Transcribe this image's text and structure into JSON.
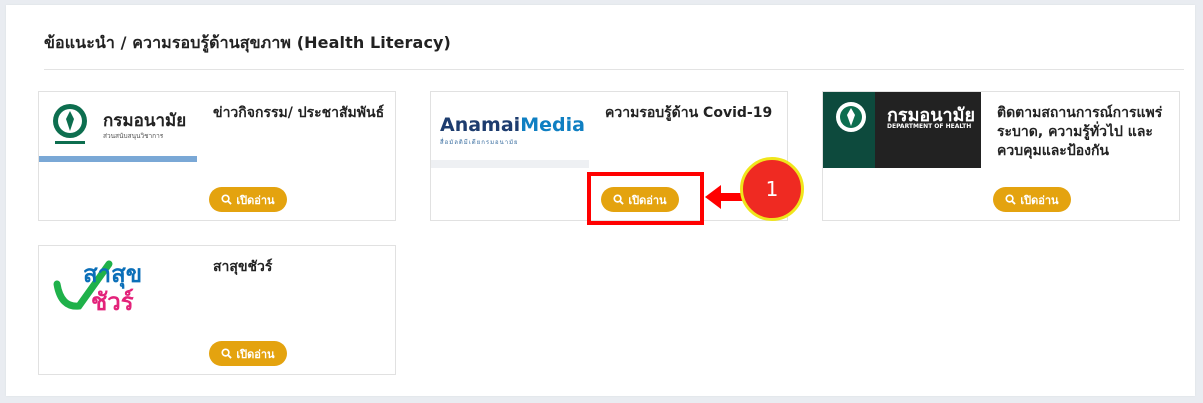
{
  "section": {
    "title": "ข้อแนะนำ / ความรอบรู้ด้านสุขภาพ (Health Literacy)"
  },
  "cards": [
    {
      "title": "ข่าวกิจกรรม/ ประชาสัมพันธ์",
      "button_label": "เปิดอ่าน",
      "thumb": {
        "brand": "กรมอนามัย",
        "sub": "ส่วนสนับสนุนวิชาการ"
      }
    },
    {
      "title": "ความรอบรู้ด้าน Covid-19",
      "button_label": "เปิดอ่าน",
      "thumb": {
        "brand_a": "Anamai",
        "brand_b": "Media",
        "sub": "สื่อมัลติมีเดียกรมอนามัย"
      }
    },
    {
      "title": "ติดตามสถานการณ์การแพร่ระบาด, ความรู้ทั่วไป และ ควบคุมและป้องกัน",
      "button_label": "เปิดอ่าน",
      "thumb": {
        "brand": "กรมอนามัย",
        "sub": "DEPARTMENT OF HEALTH"
      }
    },
    {
      "title": "สาสุขชัวร์",
      "button_label": "เปิดอ่าน",
      "thumb": {
        "line1": "สาสุข",
        "line2": "ชัวร์"
      }
    }
  ],
  "annotation": {
    "step_number": "1",
    "colors": {
      "callout_fill": "#ef2a22",
      "callout_border": "#f0e51b",
      "highlight": "#ff0000"
    }
  },
  "colors": {
    "accent_button": "#e4a30f",
    "page_bg": "#e9ecf1"
  },
  "icons": [
    "search-icon",
    "arrow-left-icon"
  ]
}
